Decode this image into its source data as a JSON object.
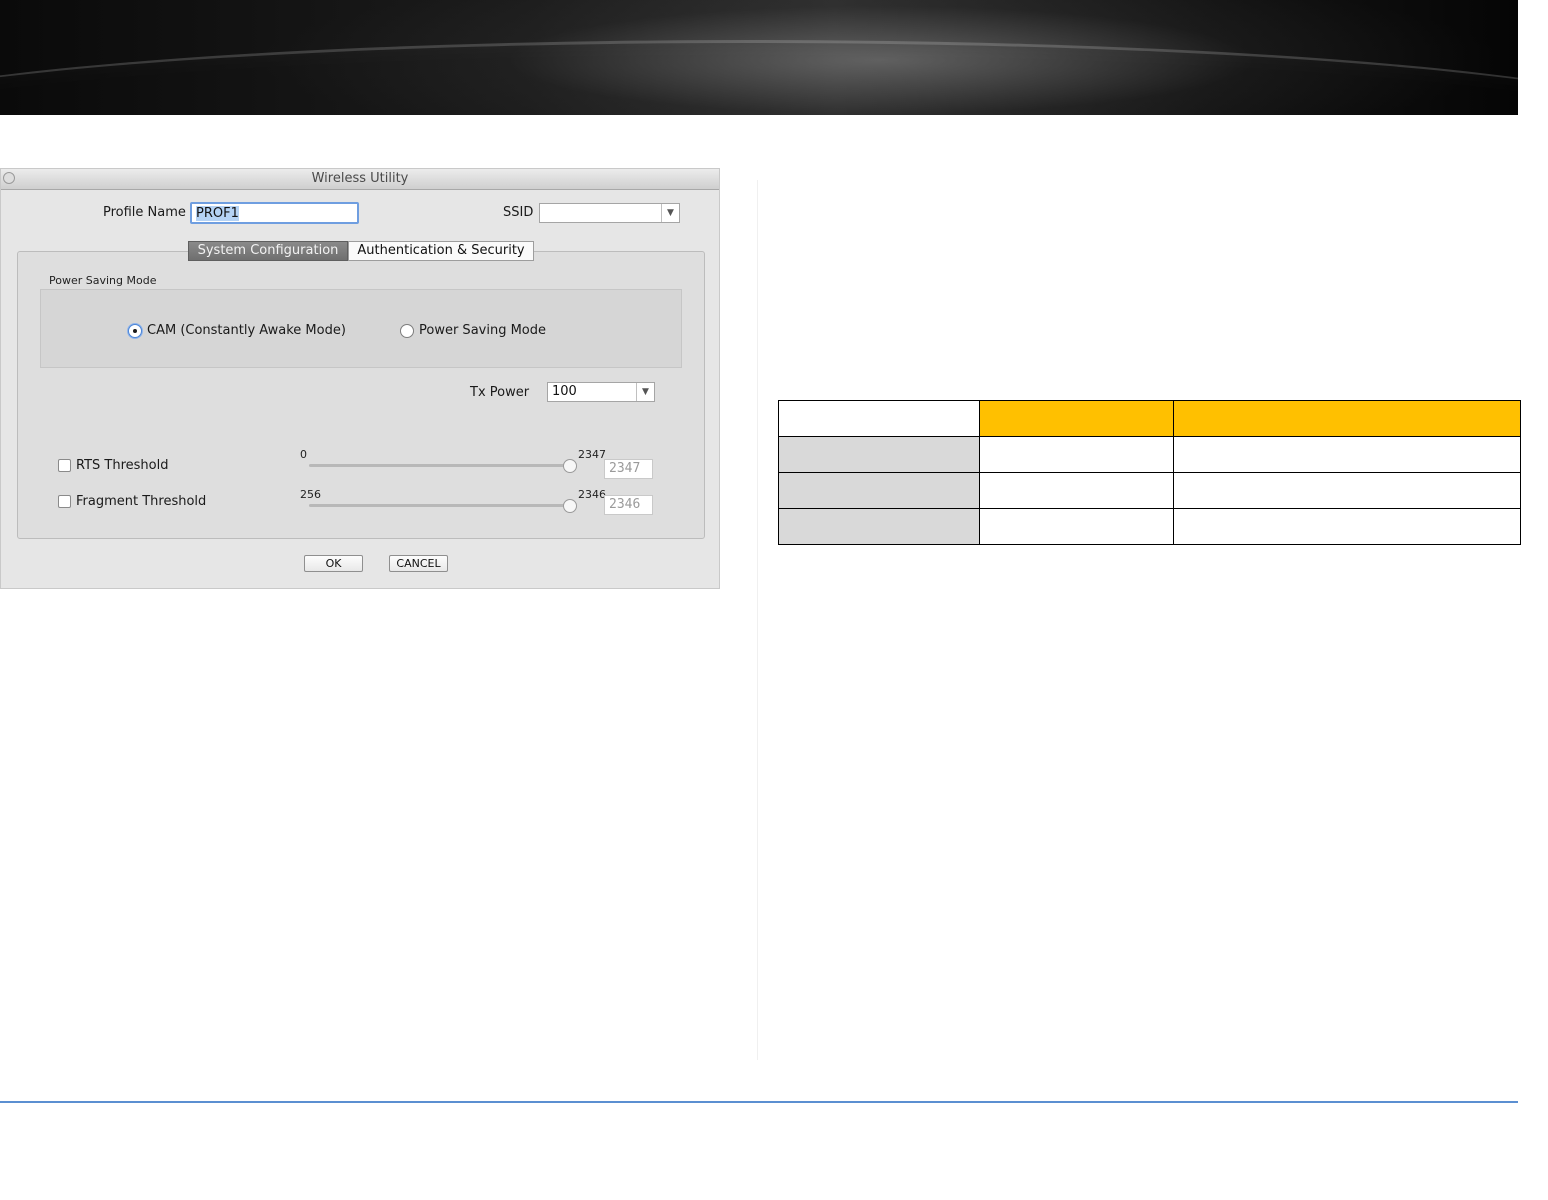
{
  "dialog": {
    "title": "Wireless Utility",
    "profile_name_label": "Profile Name",
    "profile_name_value": "PROF1",
    "ssid_label": "SSID",
    "ssid_value": "",
    "tabs": [
      {
        "label": "System Configuration",
        "active": true
      },
      {
        "label": "Authentication & Security",
        "active": false
      }
    ],
    "power_saving_group_label": "Power Saving Mode",
    "radio_options": [
      {
        "label": "CAM (Constantly Awake Mode)",
        "selected": true
      },
      {
        "label": "Power Saving Mode",
        "selected": false
      }
    ],
    "tx_power_label": "Tx Power",
    "tx_power_value": "100",
    "rts": {
      "label": "RTS Threshold",
      "checked": false,
      "min": "0",
      "max": "2347",
      "value": "2347"
    },
    "fragment": {
      "label": "Fragment Threshold",
      "checked": false,
      "min": "256",
      "max": "2346",
      "value": "2346"
    },
    "ok_label": "OK",
    "cancel_label": "CANCEL"
  },
  "colors": {
    "table_header_accent": "#ffc000",
    "table_row_label_bg": "#d9d9d9",
    "footer_rule": "#5b8fd1",
    "focus_ring": "#6f9ee0"
  }
}
